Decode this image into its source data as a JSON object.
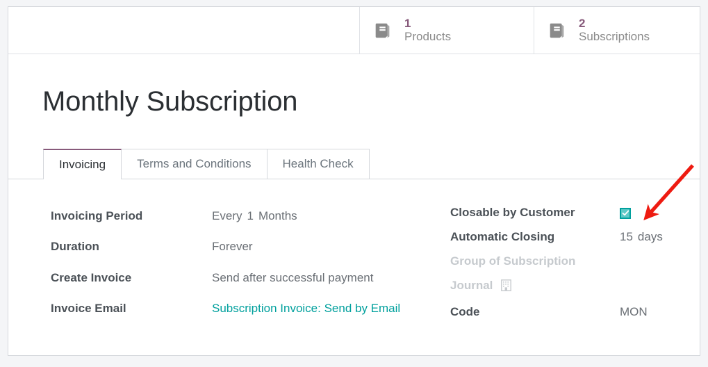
{
  "header": {
    "stat_buttons": [
      {
        "icon": "book-icon",
        "value": "1",
        "label": "Products"
      },
      {
        "icon": "book-icon",
        "value": "2",
        "label": "Subscriptions"
      }
    ]
  },
  "record": {
    "title": "Monthly Subscription"
  },
  "notebook": {
    "tabs": [
      {
        "label": "Invoicing",
        "active": true
      },
      {
        "label": "Terms and Conditions",
        "active": false
      },
      {
        "label": "Health Check",
        "active": false
      }
    ]
  },
  "form": {
    "left_group": [
      {
        "label": "Invoicing Period",
        "value_prefix": "Every",
        "value_number": "1",
        "value_suffix": "Months"
      },
      {
        "label": "Duration",
        "value": "Forever"
      },
      {
        "label": "Create Invoice",
        "value": "Send after successful payment"
      },
      {
        "label": "Invoice Email",
        "value": "Subscription Invoice: Send by Email"
      }
    ],
    "right_group": [
      {
        "label": "Closable by Customer",
        "widget": "checkbox",
        "checked": true
      },
      {
        "label": "Automatic Closing",
        "value_number": "15",
        "value_unit": "days"
      },
      {
        "label": "Group of Subscription",
        "value": ""
      },
      {
        "label": "Journal",
        "icon": "building-icon"
      },
      {
        "label": "Code",
        "value": "MON"
      }
    ]
  },
  "colors": {
    "brand_purple": "#875A7B",
    "link_teal": "#00A09D",
    "checkbox_fill": "#5FC9C7",
    "annotation_red": "#EE1B11",
    "muted_grey": "#C6CACE"
  },
  "annotation": {
    "type": "arrow",
    "points_to": "closable-by-customer-checkbox"
  }
}
